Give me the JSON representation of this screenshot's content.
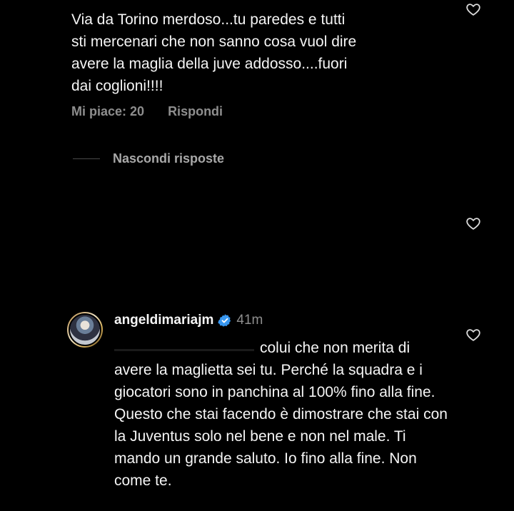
{
  "comment": {
    "text": "Via da Torino merdoso...tu paredes e tutti\nsti mercenari che non sanno cosa vuol dire\navere la maglia della juve addosso....fuori\ndai coglioni!!!!",
    "likes_label": "Mi piace: 20",
    "reply_label": "Rispondi"
  },
  "thread": {
    "hide_replies_label": "Nascondi risposte"
  },
  "reply": {
    "username": "angeldimariajm",
    "time": "41m",
    "text": "colui che non merita di avere la maglietta sei tu. Perché la squadra e i giocatori sono in panchina al 100% fino alla fine. Questo che stai facendo è dimostrare che stai con la Juventus solo nel bene e non nel male. Ti mando un grande saluto. Io fino alla fine. Non come te."
  },
  "colors": {
    "background": "#000000",
    "text": "#f5f5f5",
    "muted": "#8e8e8e",
    "verified": "#3897f0"
  },
  "icons": {
    "like": "heart-outline-icon",
    "verified": "verified-badge-icon"
  }
}
